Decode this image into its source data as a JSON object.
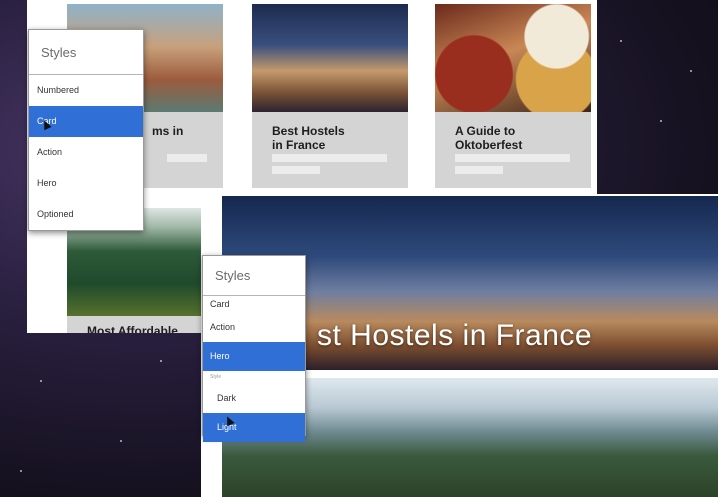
{
  "background": {
    "color": "#15111f"
  },
  "back_cards": [
    {
      "title": "Best Hostels\nin France"
    },
    {
      "title": "A Guide to\nOktoberfest"
    }
  ],
  "partial_texts": {
    "card1_tail": "ms in",
    "card4_title": "Most Affordable"
  },
  "styles_menu_1": {
    "title": "Styles",
    "items": [
      "Numbered",
      "Card",
      "Action",
      "Hero",
      "Optioned"
    ],
    "selected": "Card"
  },
  "styles_menu_2": {
    "title": "Styles",
    "items": [
      "Card",
      "Action",
      "Hero"
    ],
    "selected": "Hero",
    "sub_label": "Style",
    "sub_items": [
      "Dark",
      "Light"
    ],
    "sub_selected": "Light"
  },
  "hero": {
    "title": "st Hostels in France"
  },
  "colors": {
    "selection": "#2f6fd6",
    "card_bg": "#d4d4d4"
  }
}
